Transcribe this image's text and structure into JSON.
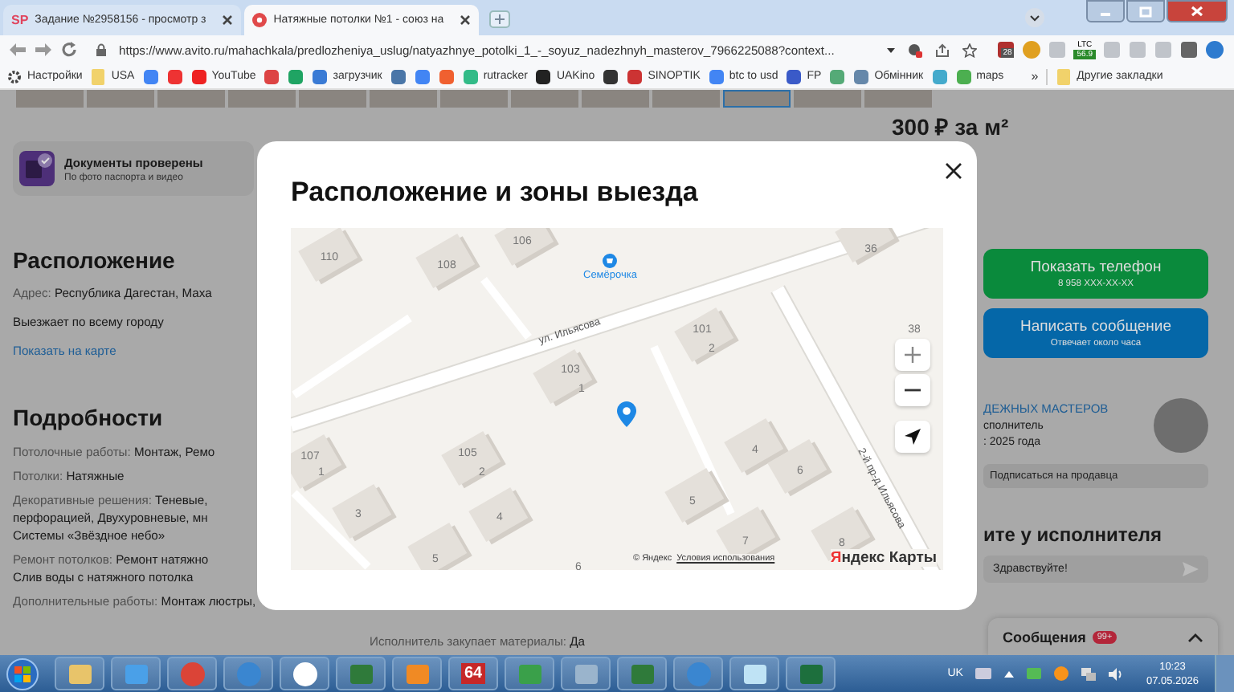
{
  "browser": {
    "tabs": [
      {
        "badge": "SP",
        "title": "Задание №2958156 - просмотр з",
        "selected": false
      },
      {
        "title": "Натяжные потолки №1 - союз на",
        "selected": true
      }
    ],
    "address": "https://www.avito.ru/mahachkala/predlozheniya_uslug/natyazhnye_potolki_1_-_soyuz_nadezhnyh_masterov_7966225088?context...",
    "extensions": [
      {
        "kind": "badge",
        "text": "28"
      },
      {
        "kind": "coin"
      },
      {
        "kind": "plain"
      },
      {
        "kind": "ticker",
        "text": "LTC",
        "value": "56.9"
      },
      {
        "kind": "plain"
      },
      {
        "kind": "plain"
      },
      {
        "kind": "plain"
      },
      {
        "kind": "puzzle"
      },
      {
        "kind": "avatar"
      }
    ],
    "bookmarks": [
      {
        "kind": "gear",
        "label": "Настройки"
      },
      {
        "kind": "folder",
        "label": "USA"
      },
      {
        "kind": "site"
      },
      {
        "kind": "site"
      },
      {
        "kind": "site",
        "label": "YouTube"
      },
      {
        "kind": "site"
      },
      {
        "kind": "site"
      },
      {
        "kind": "site",
        "label": "загрузчик"
      },
      {
        "kind": "site"
      },
      {
        "kind": "site"
      },
      {
        "kind": "site"
      },
      {
        "kind": "site",
        "label": "rutracker"
      },
      {
        "kind": "site",
        "label": "UAKino"
      },
      {
        "kind": "site"
      },
      {
        "kind": "site",
        "label": "SINOPTIK"
      },
      {
        "kind": "site",
        "label": "btc to usd"
      },
      {
        "kind": "site",
        "label": "FP"
      },
      {
        "kind": "site"
      },
      {
        "kind": "site",
        "label": "Обмінник"
      },
      {
        "kind": "site"
      },
      {
        "kind": "site",
        "label": "maps"
      }
    ],
    "more": "»",
    "other": {
      "kind": "folder",
      "label": "Другие закладки"
    }
  },
  "page": {
    "verification": {
      "title": "Документы проверены",
      "subtitle": "По фото паспорта и видео"
    },
    "location": {
      "heading": "Расположение",
      "address_label": "Адрес:",
      "address": "Республика Дагестан, Маха",
      "note": "Выезжает по всему городу",
      "link": "Показать на карте"
    },
    "details": {
      "heading": "Подробности",
      "items": [
        {
          "label": "Потолочные работы:",
          "value": "Монтаж, Ремо"
        },
        {
          "label": "Потолки:",
          "value": "Натяжные"
        },
        {
          "label": "Декоративные решения:",
          "value": "Теневые,\nперфорацией, Двухуровневые, мн\nСистемы «Звёздное небо»"
        },
        {
          "label": "Ремонт потолков:",
          "value": "Ремонт натяжно\nСлив воды с натяжного потолка"
        },
        {
          "label": "Дополнительные работы:",
          "value": "Монтаж люстры,"
        }
      ]
    },
    "middle": [
      {
        "label": "Исполнитель закупает материалы:",
        "value": "Да"
      }
    ],
    "sidebar": {
      "price": "300 ₽ за м²",
      "buttons": [
        {
          "kind": "phone",
          "title": "Показать телефон",
          "subtitle": "8 958 XXX-XX-XX"
        },
        {
          "kind": "message",
          "title": "Написать сообщение",
          "subtitle": "Отвечает около часа"
        }
      ],
      "seller": {
        "name": "ДЕЖНЫХ МАСТЕРОВ",
        "role": "сполнитель",
        "since": ": 2025 года"
      },
      "subscribe": "Подписаться на продавца",
      "ask_heading": "ите у исполнителя",
      "message_value": "Здравствуйте!"
    },
    "chat": {
      "title": "Сообщения",
      "badge": "99+"
    }
  },
  "modal": {
    "title": "Расположение и зоны выезда",
    "map": {
      "labels": [
        "110",
        "108",
        "106",
        "36",
        "101",
        "2",
        "38",
        "103",
        "1",
        "107",
        "1",
        "105",
        "2",
        "3",
        "4",
        "5",
        "4",
        "6",
        "5",
        "7",
        "8",
        "6"
      ],
      "streets": [
        "ул. Ильясова",
        "2-й пр-д Ильясова"
      ],
      "poi": "Семёрочка",
      "copyright": "© Яндекс",
      "terms": "Условия использования",
      "logo_mark": "Я",
      "logo_rest": "ндекс Карты"
    }
  },
  "taskbar": {
    "apps": [
      {
        "kind": "folder"
      },
      {
        "kind": "shield"
      },
      {
        "kind": "browser"
      },
      {
        "kind": "globe"
      },
      {
        "kind": "yandex"
      },
      {
        "kind": "board"
      },
      {
        "kind": "player"
      },
      {
        "kind": "tile",
        "label": "64"
      },
      {
        "kind": "flag"
      },
      {
        "kind": "calc"
      },
      {
        "kind": "board"
      },
      {
        "kind": "globe"
      },
      {
        "kind": "note"
      },
      {
        "kind": "sheet"
      }
    ],
    "language": "UK",
    "time": "10:23",
    "date": "07.05.2026"
  }
}
